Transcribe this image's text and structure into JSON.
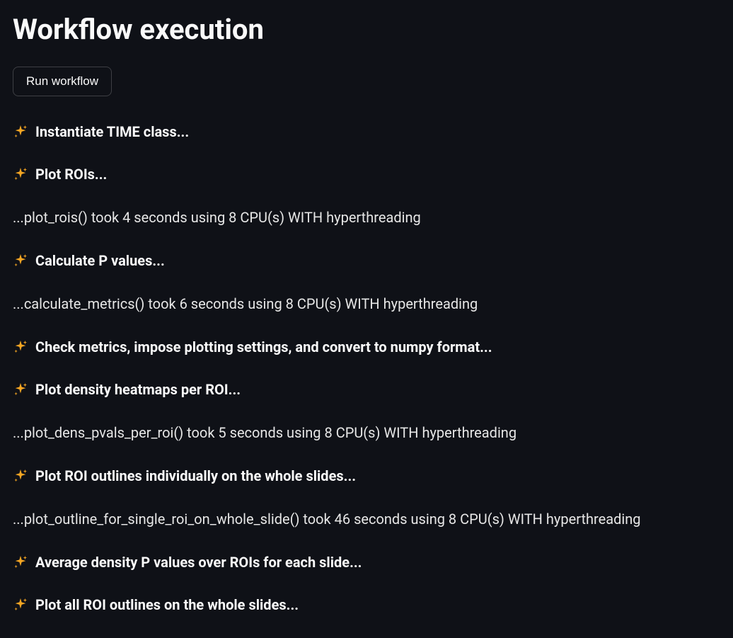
{
  "title": "Workflow execution",
  "button": {
    "run_label": "Run workflow"
  },
  "log": [
    {
      "type": "step",
      "text": "Instantiate TIME class..."
    },
    {
      "type": "step",
      "text": "Plot ROIs..."
    },
    {
      "type": "output",
      "text": "...plot_rois() took 4 seconds using 8 CPU(s) WITH hyperthreading"
    },
    {
      "type": "step",
      "text": "Calculate P values..."
    },
    {
      "type": "output",
      "text": "...calculate_metrics() took 6 seconds using 8 CPU(s) WITH hyperthreading"
    },
    {
      "type": "step",
      "text": "Check metrics, impose plotting settings, and convert to numpy format..."
    },
    {
      "type": "step",
      "text": "Plot density heatmaps per ROI..."
    },
    {
      "type": "output",
      "text": "...plot_dens_pvals_per_roi() took 5 seconds using 8 CPU(s) WITH hyperthreading"
    },
    {
      "type": "step",
      "text": "Plot ROI outlines individually on the whole slides..."
    },
    {
      "type": "output",
      "text": "...plot_outline_for_single_roi_on_whole_slide() took 46 seconds using 8 CPU(s) WITH hyperthreading"
    },
    {
      "type": "step",
      "text": "Average density P values over ROIs for each slide..."
    },
    {
      "type": "step",
      "text": "Plot all ROI outlines on the whole slides..."
    }
  ]
}
